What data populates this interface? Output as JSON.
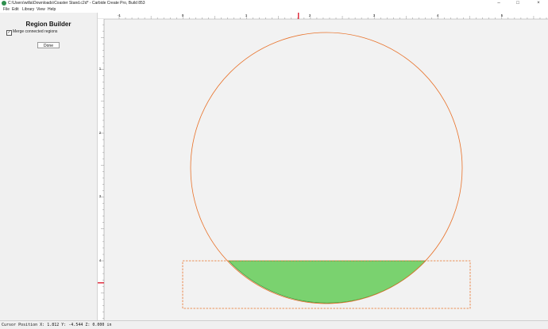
{
  "window": {
    "title": "C:\\Users\\willa\\Downloads\\Coaster Stand.c2d* - Carbide Create Pro, Build 853",
    "minimize_glyph": "–",
    "maximize_glyph": "□",
    "close_glyph": "×"
  },
  "menu": [
    "File",
    "Edit",
    "Library",
    "View",
    "Help"
  ],
  "panel": {
    "title": "Region Builder",
    "merge_label": "Merge connected regions",
    "merge_checked": true,
    "check_glyph": "✓",
    "done_label": "Done"
  },
  "ruler": {
    "h_labels": [
      "-1",
      "0",
      "1",
      "2",
      "3",
      "4",
      "5"
    ],
    "v_labels": [
      "1",
      "2",
      "3",
      "4"
    ]
  },
  "status": {
    "cursor_text": "Cursor Position X: 1.812 Y: -4.544 Z: 0.000 in"
  },
  "colors": {
    "orange": "#e8722a",
    "green_fill": "#7ad26f",
    "green_stroke": "#3e9a3e",
    "ruler_marker": "#e03040"
  }
}
